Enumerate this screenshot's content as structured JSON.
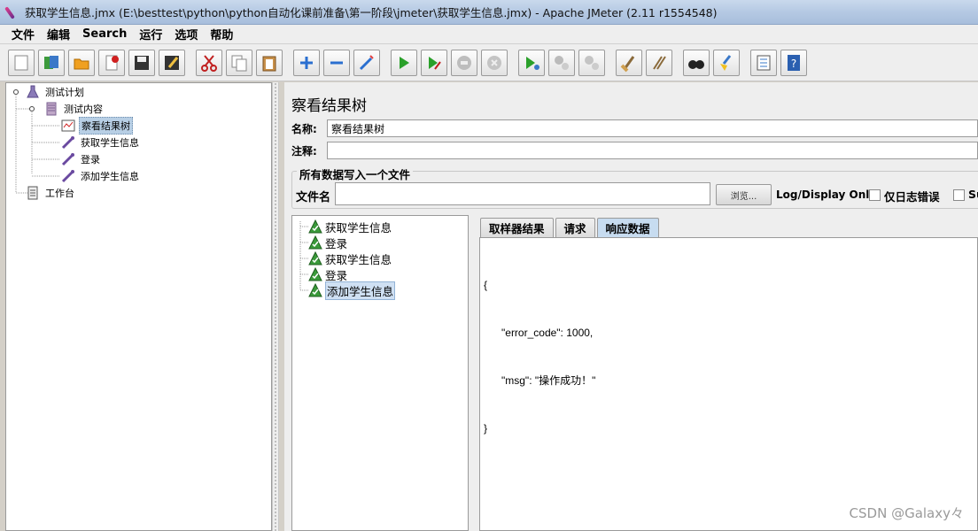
{
  "window": {
    "title": "获取学生信息.jmx (E:\\besttest\\python\\python自动化课前准备\\第一阶段\\jmeter\\获取学生信息.jmx) - Apache JMeter (2.11 r1554548)"
  },
  "menu": [
    "文件",
    "编辑",
    "Search",
    "运行",
    "选项",
    "帮助"
  ],
  "toolbar": {
    "buttons": [
      "new",
      "templates",
      "open",
      "close",
      "save",
      "save-as",
      "cut",
      "copy",
      "paste",
      "expand",
      "collapse",
      "toggle",
      "start",
      "start-no-timers",
      "stop",
      "shutdown",
      "remote-start",
      "remote-stop",
      "remote-shutdown",
      "clear",
      "clear-all",
      "search",
      "reset-search",
      "function-helper",
      "help"
    ]
  },
  "tree": {
    "items": [
      "测试计划",
      "测试内容",
      "察看结果树",
      "获取学生信息",
      "登录",
      "添加学生信息",
      "工作台"
    ]
  },
  "panel": {
    "title": "察看结果树",
    "name_label": "名称:",
    "name_value": "察看结果树",
    "comment_label": "注释:",
    "comment_value": "",
    "file_group_title": "所有数据写入一个文件",
    "file_label": "文件名",
    "browse_label": "浏览...",
    "log_display_label": "Log/Display Only:",
    "errors_only_label": "仅日志错误",
    "successes_label": "Su"
  },
  "results": {
    "samples": [
      "获取学生信息",
      "登录",
      "获取学生信息",
      "登录",
      "添加学生信息"
    ],
    "tabs": [
      "取样器结果",
      "请求",
      "响应数据"
    ],
    "active_tab": "响应数据",
    "response_lines": [
      "{",
      "      \"error_code\": 1000,",
      "      \"msg\": \"操作成功！\"",
      "}"
    ]
  },
  "watermark": "CSDN @Galaxy々"
}
